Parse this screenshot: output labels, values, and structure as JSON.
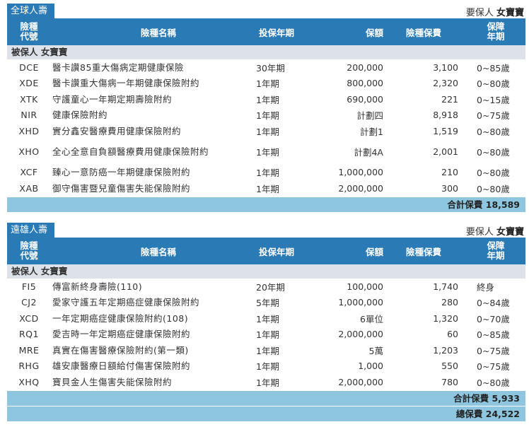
{
  "header_labels": {
    "code": "險種\n代號",
    "name": "險種名稱",
    "years": "投保年期",
    "amount": "保額",
    "premium": "險種保費",
    "term": "保障\n年期"
  },
  "sections": [
    {
      "company": "全球人壽",
      "insured_label": "要保人",
      "insured_name": "女寶寶",
      "subheader": "被保人 女寶寶",
      "rows": [
        {
          "code": "DCE",
          "name": "醫卡讚85重大傷病定期健康保險",
          "years": "30年期",
          "amount": "200,000",
          "premium": "3,100",
          "term": "0~85歲"
        },
        {
          "code": "XDE",
          "name": "醫卡讚重大傷病一年期健康保險附約",
          "years": "1年期",
          "amount": "800,000",
          "premium": "2,320",
          "term": "0~80歲"
        },
        {
          "code": "XTK",
          "name": "守護童心一年期定期壽險附約",
          "years": "1年期",
          "amount": "690,000",
          "premium": "221",
          "term": "0~15歲"
        },
        {
          "code": "NIR",
          "name": "健康保險附約",
          "years": "1年期",
          "amount": "計劃四",
          "premium": "8,918",
          "term": "0~75歲"
        },
        {
          "code": "XHD",
          "name": "實分鑫安醫療費用健康保險附約",
          "years": "1年期",
          "amount": "計劃1",
          "premium": "1,519",
          "term": "0~80歲"
        },
        {
          "code": "XHO",
          "name": "全心全意自負額醫療費用健康保險附約",
          "years": "1年期",
          "amount": "計劃4A",
          "premium": "2,001",
          "term": "0~80歲",
          "tall": true
        },
        {
          "code": "XCF",
          "name": "臻心一意防癌一年期健康保險附約",
          "years": "1年期",
          "amount": "1,000,000",
          "premium": "210",
          "term": "0~80歲"
        },
        {
          "code": "XAB",
          "name": "御守傷害暨兒童傷害失能保險附約",
          "years": "1年期",
          "amount": "2,000,000",
          "premium": "300",
          "term": "0~80歲"
        }
      ],
      "subtotal": "合計保費 18,589"
    },
    {
      "company": "遠雄人壽",
      "insured_label": "要保人",
      "insured_name": "女寶寶",
      "subheader": "被保人 女寶寶",
      "rows": [
        {
          "code": "FI5",
          "name": "傳富新終身壽險(110)",
          "years": "20年期",
          "amount": "100,000",
          "premium": "1,740",
          "term": "終身"
        },
        {
          "code": "CJ2",
          "name": "愛家守護五年定期癌症健康保險附約",
          "years": "5年期",
          "amount": "1,000,000",
          "premium": "280",
          "term": "0~84歲"
        },
        {
          "code": "XCD",
          "name": "一年定期癌症健康保險附約(108)",
          "years": "1年期",
          "amount": "6單位",
          "premium": "1,320",
          "term": "0~70歲"
        },
        {
          "code": "RQ1",
          "name": "愛吉時一年定期癌症健康保險附約",
          "years": "1年期",
          "amount": "2,000,000",
          "premium": "60",
          "term": "0~85歲"
        },
        {
          "code": "MRE",
          "name": "真實在傷害醫療保險附約(第一類)",
          "years": "1年期",
          "amount": "5萬",
          "premium": "1,203",
          "term": "0~75歲"
        },
        {
          "code": "RHG",
          "name": "雄安康醫療日額給付傷害保險附約",
          "years": "1年期",
          "amount": "1,000",
          "premium": "550",
          "term": "0~75歲"
        },
        {
          "code": "XHQ",
          "name": "寶貝金人生傷害失能保險附約",
          "years": "1年期",
          "amount": "2,000,000",
          "premium": "780",
          "term": "0~80歲"
        }
      ],
      "subtotal": "合計保費 5,933"
    }
  ],
  "grand_total": "總保費 24,522"
}
